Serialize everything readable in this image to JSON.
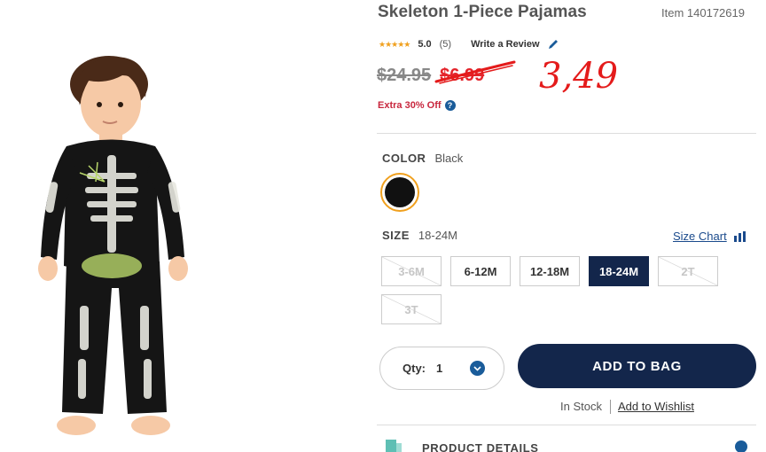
{
  "product": {
    "title": "Skeleton 1-Piece Pajamas",
    "item_label": "Item 140172619",
    "image_icon": "toddler-skeleton-pajamas-photo"
  },
  "rating": {
    "stars": "★★★★★",
    "value": "5.0",
    "count": "(5)",
    "write_review": "Write a Review"
  },
  "price": {
    "original": "$24.95",
    "sale": "$6.99",
    "handwritten": "3,49"
  },
  "promo": {
    "text": "Extra 30% Off",
    "help": "?"
  },
  "color": {
    "label": "COLOR",
    "value": "Black",
    "swatch_hex": "#111111",
    "ring_hex": "#f0a01e"
  },
  "size": {
    "label": "SIZE",
    "value": "18-24M",
    "chart_link": "Size Chart",
    "options": [
      "3-6M",
      "6-12M",
      "12-18M",
      "18-24M",
      "2T",
      "3T"
    ]
  },
  "quantity": {
    "label": "Qty:",
    "value": "1"
  },
  "actions": {
    "add_to_bag": "ADD TO BAG",
    "in_stock": "In Stock",
    "wishlist": "Add to Wishlist"
  },
  "details": {
    "label": "PRODUCT DETAILS"
  },
  "colors": {
    "navy": "#13264b",
    "accent_blue": "#1a5c9a",
    "sale_red": "#e4252c",
    "star_gold": "#f0a01e"
  }
}
